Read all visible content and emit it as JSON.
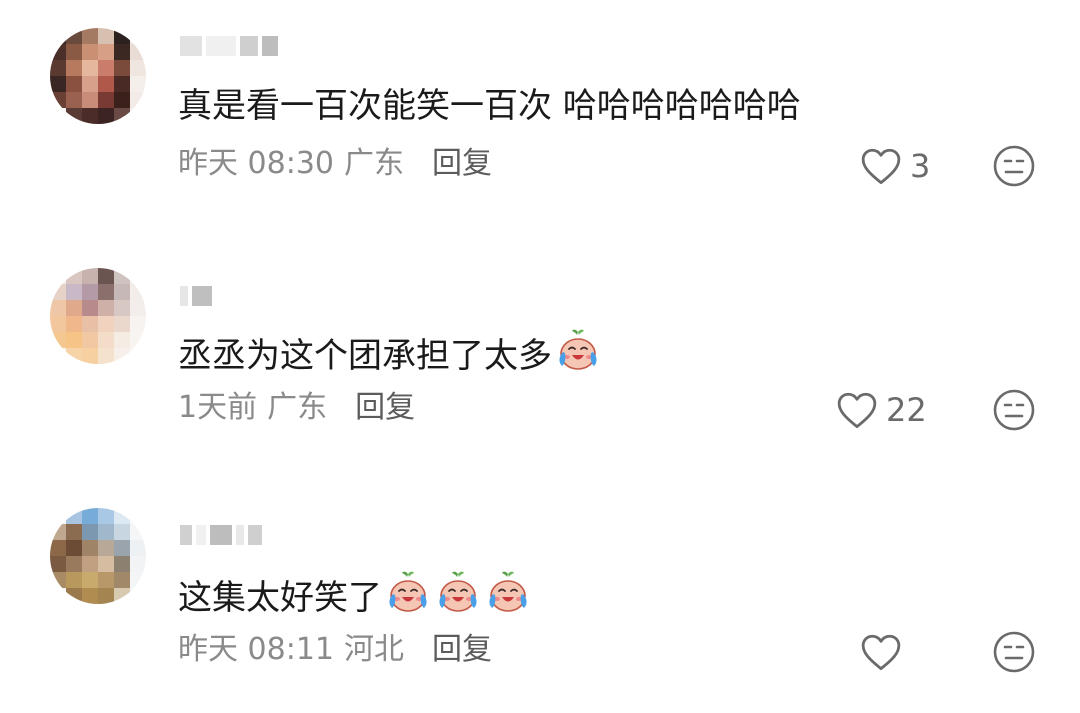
{
  "comments": [
    {
      "text": "真是看一百次能笑一百次  哈哈哈哈哈哈哈",
      "time": "昨天 08:30",
      "location": "广东",
      "reply_label": "回复",
      "likes": "3",
      "emoji_count": 0,
      "avatar_colors": [
        "#3a2a26",
        "#6b4a3e",
        "#a47a63",
        "#d8c0b0",
        "#2b2220",
        "#f3ece8",
        "#4a3028",
        "#8b5a44",
        "#c99073",
        "#d7a086",
        "#3c2822",
        "#e9dcd4",
        "#5a3a30",
        "#b77a5f",
        "#e5b79c",
        "#c97d6a",
        "#7a4a3b",
        "#f0e6e0",
        "#3a2622",
        "#8a5040",
        "#d6a08a",
        "#b0584a",
        "#4a2a24",
        "#f5efeb",
        "#6a4034",
        "#9a6050",
        "#c98c78",
        "#7a3a34",
        "#3c201c",
        "#f2ebe7",
        "#f6f2ef",
        "#5a3a34",
        "#4c2c28",
        "#3c2422",
        "#6a4a44",
        "#f5f0ed"
      ]
    },
    {
      "text": "丞丞为这个团承担了太多",
      "time": "1天前",
      "location": "广东",
      "reply_label": "回复",
      "likes": "22",
      "emoji_count": 1,
      "avatar_colors": [
        "#f3efec",
        "#d9c6c0",
        "#c8b2ae",
        "#6b5550",
        "#cfc3c0",
        "#f4f1ee",
        "#e6d2c6",
        "#c9b9c6",
        "#b49aa6",
        "#8a6f6c",
        "#c6b8b6",
        "#f2ede9",
        "#efc7a6",
        "#e0a98c",
        "#b78a8c",
        "#cfb0a8",
        "#d8c8c4",
        "#f3eeeb",
        "#f2c79e",
        "#f0b88a",
        "#e8c0a6",
        "#f0d2be",
        "#ead8cc",
        "#f6f3f0",
        "#f4c890",
        "#f6c486",
        "#f1c8a2",
        "#f3ddc8",
        "#f5ece4",
        "#f7f4f1",
        "#f7f4f1",
        "#f6d4a8",
        "#f6d0a0",
        "#f5e2cc",
        "#f7f0ea",
        "#f7f4f1"
      ]
    },
    {
      "text": "这集太好笑了",
      "time": "昨天 08:11",
      "location": "河北",
      "reply_label": "回复",
      "likes": "",
      "emoji_count": 3,
      "avatar_colors": [
        "#f4f6f8",
        "#a8c4e0",
        "#78acd8",
        "#a8c8e6",
        "#dce8f2",
        "#f5f7f9",
        "#c0a890",
        "#8c6c50",
        "#7c98b0",
        "#a0b8cc",
        "#c8d6e2",
        "#f4f6f8",
        "#8c6848",
        "#6c4c34",
        "#a08468",
        "#b8a898",
        "#9aa4ac",
        "#eef1f4",
        "#7a5a40",
        "#9a7a5c",
        "#c0a080",
        "#d6bca0",
        "#8c8070",
        "#f1f3f5",
        "#a88a64",
        "#b8985c",
        "#c8aa6c",
        "#b89868",
        "#a08868",
        "#f4f5f6",
        "#f6f6f6",
        "#9a7a4c",
        "#b08c50",
        "#a48450",
        "#d8cab0",
        "#f6f6f6"
      ]
    }
  ]
}
